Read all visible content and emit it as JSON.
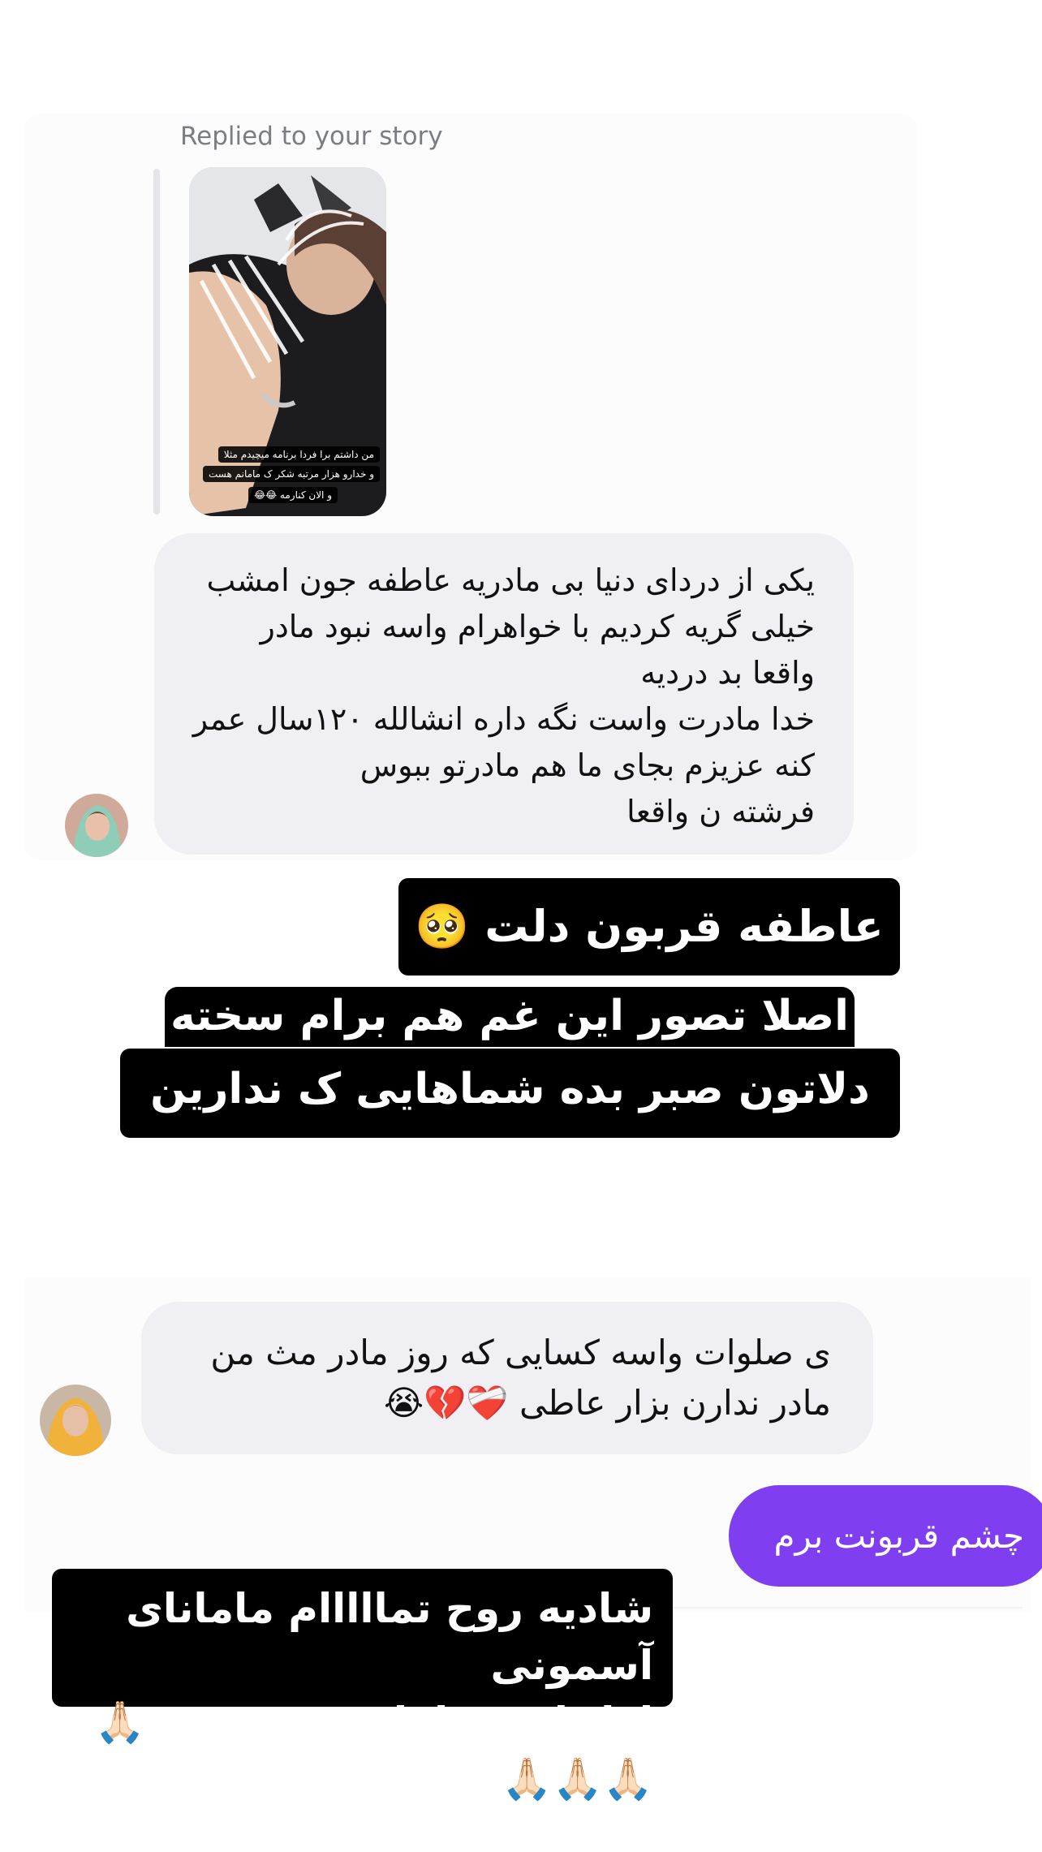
{
  "story_reply": {
    "label": "Replied to your story",
    "story_caption_lines": [
      "من داشتم برا فردا برنامه میچیدم مثلا",
      "و خدارو هزار مرتبه شکر ک مامانم هست",
      "و الان کنارمه 😂😂"
    ]
  },
  "messages": {
    "incoming_1_lines": [
      "یکی از دردای دنیا بی مادریه عاطفه جون امشب",
      "خیلی گریه کردیم با خواهرام واسه نبود مادر",
      "واقعا بد دردیه",
      "خدا مادرت واست نگه داره انشالله ۱۲۰سال عمر",
      "کنه عزیزم بجای ما هم مادرتو ببوس",
      "فرشته ن واقعا"
    ],
    "sticker_1": "عاطفه قربون دلت 🥺🥺",
    "sticker_2_line1": "اصلا تصور این غم هم برام سخته خدا ب",
    "sticker_2_line2": "دلاتون صبر بده شماهایی ک ندارین مادراتونو",
    "incoming_2_lines": [
      "ی صلوات واسه کسایی که روز مادر مث من",
      "مادر ندارن بزار عاطی ❤️‍🩹💔😭"
    ],
    "outgoing_1": "چشم قربونت برم",
    "sticker_3_line1": "شادیه روح تمااااام ماماناى آسمونى",
    "sticker_3_line2": "لطفا ی صلوات بفرستین 🙏🏻🙏🏻🙏🏻🙏🏻"
  },
  "colors": {
    "incoming_bubble": "#efeff4",
    "outgoing_bubble": "#7f3ff0",
    "sticker_bg": "#000000",
    "reply_label": "#7a7d82"
  },
  "icons": {
    "avatar_1": "user-avatar-green-hijab",
    "avatar_2": "user-avatar-yellow-scarf"
  }
}
